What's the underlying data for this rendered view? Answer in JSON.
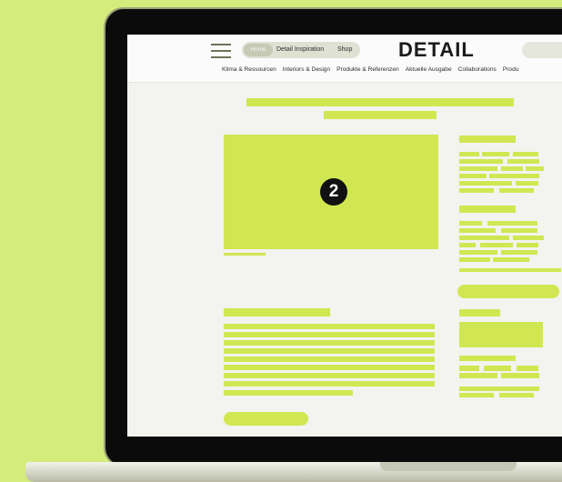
{
  "site": {
    "logo": "DETAIL",
    "nav": {
      "home": "Home",
      "inspiration": "Detail Inspiration",
      "shop": "Shop"
    },
    "categories": [
      "Klima & Ressourcen",
      "Interiors & Design",
      "Produkte & Referenzen",
      "Aktuelle Ausgabe",
      "Collaborations",
      "Produ"
    ]
  },
  "annotation": {
    "badge_number": "2"
  },
  "colors": {
    "accent": "#d1e752",
    "background": "#d3ec7c",
    "page": "#f3f3ef",
    "bezel": "#0b0b0b"
  },
  "icons": [
    "menu-icon"
  ]
}
